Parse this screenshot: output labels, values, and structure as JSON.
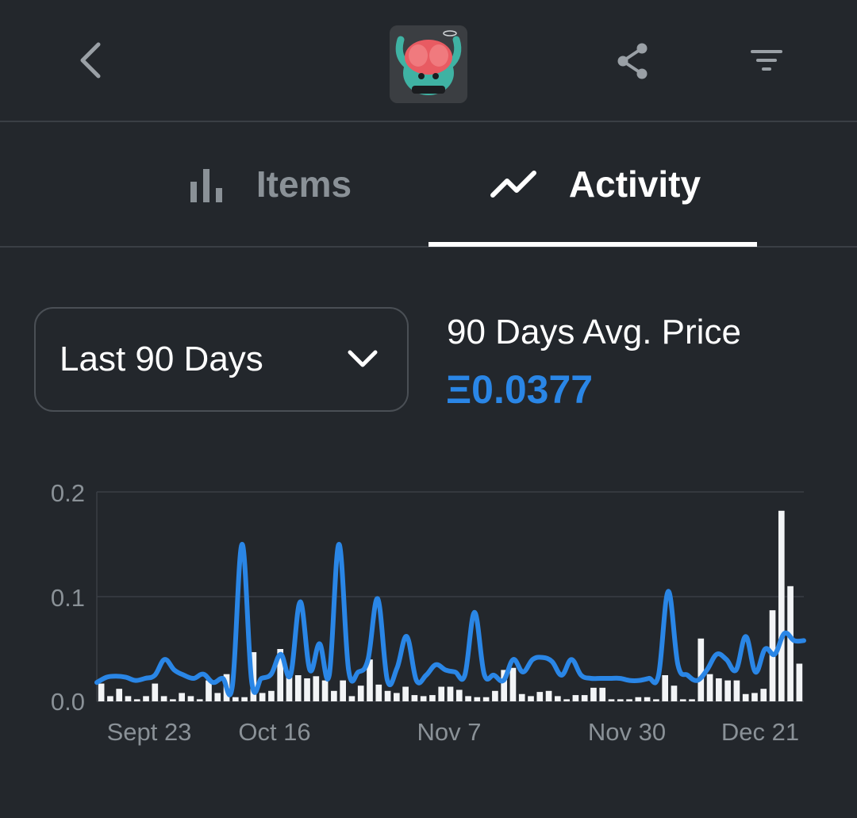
{
  "header": {
    "back_icon": "chevron-left-icon",
    "share_icon": "share-icon",
    "filter_icon": "filter-icon"
  },
  "tabs": [
    {
      "label": "Items",
      "icon": "bar-chart-icon",
      "active": false
    },
    {
      "label": "Activity",
      "icon": "trend-line-icon",
      "active": true
    }
  ],
  "range_select": {
    "selected": "Last 90 Days"
  },
  "avg_price": {
    "title": "90 Days Avg. Price",
    "value": "Ξ0.0377"
  },
  "colors": {
    "accent": "#2a86e6",
    "bars": "#f2f4f6",
    "background": "#23272c"
  },
  "chart_data": {
    "type": "bar",
    "y_ticks": [
      "0.2",
      "0.1",
      "0.0"
    ],
    "ylim": [
      0,
      0.2
    ],
    "x_tick_labels": [
      "Sept 23",
      "Oct 16",
      "Nov 7",
      "Nov 30",
      "Dec 21"
    ],
    "grid": true,
    "series": [
      {
        "kind": "bar",
        "values": [
          0.017,
          0.005,
          0.012,
          0.005,
          0.002,
          0.005,
          0.017,
          0.005,
          0.002,
          0.008,
          0.005,
          0.002,
          0.02,
          0.008,
          0.026,
          0.004,
          0.004,
          0.047,
          0.008,
          0.01,
          0.05,
          0.026,
          0.025,
          0.022,
          0.024,
          0.02,
          0.01,
          0.02,
          0.005,
          0.015,
          0.04,
          0.016,
          0.01,
          0.008,
          0.014,
          0.006,
          0.005,
          0.006,
          0.014,
          0.014,
          0.011,
          0.005,
          0.004,
          0.004,
          0.01,
          0.03,
          0.032,
          0.007,
          0.005,
          0.009,
          0.01,
          0.005,
          0.002,
          0.006,
          0.006,
          0.013,
          0.013,
          0.002,
          0.002,
          0.002,
          0.004,
          0.004,
          0.002,
          0.025,
          0.015,
          0.002,
          0.002,
          0.06,
          0.026,
          0.022,
          0.02,
          0.02,
          0.007,
          0.008,
          0.012,
          0.087,
          0.182,
          0.11,
          0.036
        ]
      },
      {
        "kind": "line",
        "values": [
          0.018,
          0.023,
          0.024,
          0.023,
          0.02,
          0.022,
          0.025,
          0.04,
          0.03,
          0.025,
          0.022,
          0.026,
          0.018,
          0.022,
          0.015,
          0.15,
          0.018,
          0.022,
          0.026,
          0.045,
          0.025,
          0.095,
          0.03,
          0.055,
          0.025,
          0.15,
          0.03,
          0.028,
          0.04,
          0.098,
          0.02,
          0.032,
          0.062,
          0.02,
          0.025,
          0.035,
          0.03,
          0.028,
          0.025,
          0.085,
          0.026,
          0.025,
          0.02,
          0.04,
          0.028,
          0.04,
          0.042,
          0.038,
          0.025,
          0.04,
          0.025,
          0.022,
          0.022,
          0.022,
          0.022,
          0.02,
          0.02,
          0.022,
          0.025,
          0.105,
          0.035,
          0.025,
          0.02,
          0.03,
          0.045,
          0.04,
          0.03,
          0.062,
          0.028,
          0.05,
          0.045,
          0.065,
          0.058,
          0.058
        ]
      }
    ]
  }
}
